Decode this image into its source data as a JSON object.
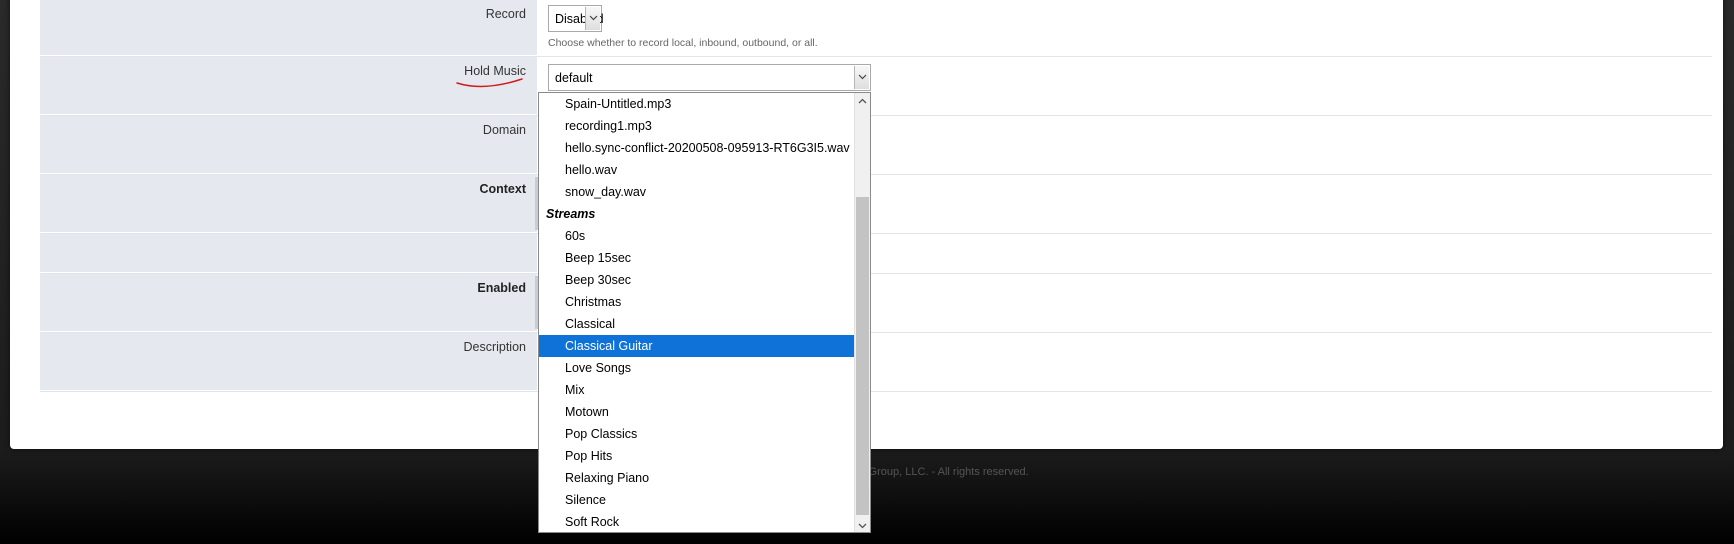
{
  "form": {
    "record": {
      "label": "Record",
      "value": "Disabled",
      "hint": "Choose whether to record local, inbound, outbound, or all."
    },
    "hold_music": {
      "label": "Hold Music",
      "value": "default"
    },
    "domain": {
      "label": "Domain"
    },
    "context": {
      "label": "Context"
    },
    "enabled": {
      "label": "Enabled"
    },
    "description": {
      "label": "Description"
    }
  },
  "dropdown": {
    "options": [
      {
        "text": "Spain-Untitled.mp3"
      },
      {
        "text": "recording1.mp3"
      },
      {
        "text": "hello.sync-conflict-20200508-095913-RT6G3I5.wav"
      },
      {
        "text": "hello.wav"
      },
      {
        "text": "snow_day.wav"
      }
    ],
    "group_label": "Streams",
    "streams": [
      {
        "text": "60s"
      },
      {
        "text": "Beep 15sec"
      },
      {
        "text": "Beep 30sec"
      },
      {
        "text": "Christmas"
      },
      {
        "text": "Classical"
      },
      {
        "text": "Classical Guitar"
      },
      {
        "text": "Love Songs"
      },
      {
        "text": "Mix"
      },
      {
        "text": "Motown"
      },
      {
        "text": "Pop Classics"
      },
      {
        "text": "Pop Hits"
      },
      {
        "text": "Relaxing Piano"
      },
      {
        "text": "Silence"
      },
      {
        "text": "Soft Rock"
      }
    ],
    "selected": "Classical Guitar"
  },
  "footer": {
    "text": "y Group, LLC. - All rights reserved."
  },
  "colors": {
    "selected_bg": "#0f72d8",
    "label_bg": "#e5e9ef",
    "annotation": "#d11a1a"
  }
}
